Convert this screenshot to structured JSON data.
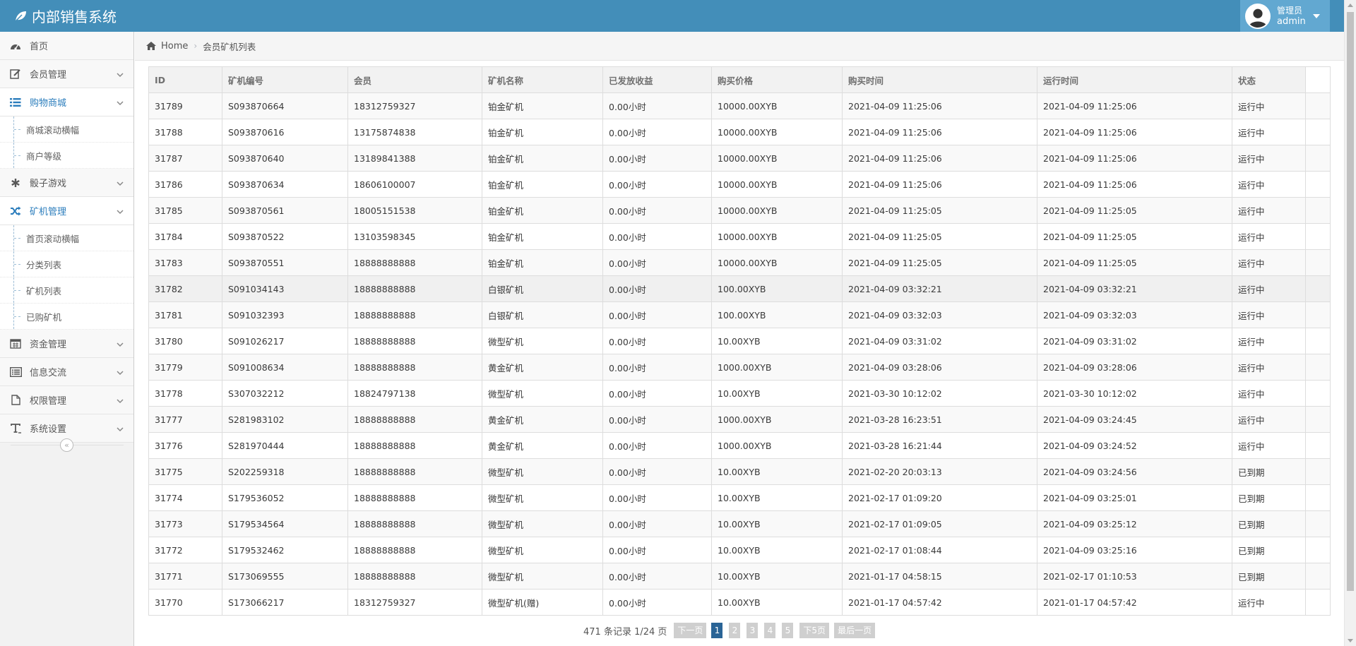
{
  "app": {
    "title": "内部销售系统"
  },
  "user": {
    "role": "管理员",
    "name": "admin"
  },
  "colors": {
    "navbar": "#438eb9",
    "user_menu": "#62a8d1",
    "active_nav": "#2b7dbc",
    "current_page": "#2a6496"
  },
  "sidebar": {
    "items": [
      {
        "label": "首页",
        "icon": "dashboard-icon",
        "active": false,
        "expandable": false
      },
      {
        "label": "会员管理",
        "icon": "edit-icon",
        "active": false,
        "expandable": true
      },
      {
        "label": "购物商城",
        "icon": "list-icon",
        "active": true,
        "expandable": true,
        "children": [
          "商城滚动横幅",
          "商户等级"
        ]
      },
      {
        "label": "骰子游戏",
        "icon": "asterisk-icon",
        "active": false,
        "expandable": true
      },
      {
        "label": "矿机管理",
        "icon": "shuffle-icon",
        "active": true,
        "expandable": true,
        "children": [
          "首页滚动横幅",
          "分类列表",
          "矿机列表",
          "已购矿机"
        ]
      },
      {
        "label": "资金管理",
        "icon": "calendar-icon",
        "active": false,
        "expandable": true
      },
      {
        "label": "信息交流",
        "icon": "list-alt-icon",
        "active": false,
        "expandable": true
      },
      {
        "label": "权限管理",
        "icon": "file-icon",
        "active": false,
        "expandable": true
      },
      {
        "label": "系统设置",
        "icon": "text-icon",
        "active": false,
        "expandable": true
      }
    ]
  },
  "breadcrumb": {
    "home": "Home",
    "current": "会员矿机列表"
  },
  "table": {
    "headers": [
      "ID",
      "矿机编号",
      "会员",
      "矿机名称",
      "已发放收益",
      "购买价格",
      "购买时间",
      "运行时间",
      "状态"
    ],
    "rows": [
      [
        "31789",
        "S093870664",
        "18312759327",
        "铂金矿机",
        "0.00小时",
        "10000.00XYB",
        "2021-04-09 11:25:06",
        "2021-04-09 11:25:06",
        "运行中"
      ],
      [
        "31788",
        "S093870616",
        "13175874838",
        "铂金矿机",
        "0.00小时",
        "10000.00XYB",
        "2021-04-09 11:25:06",
        "2021-04-09 11:25:06",
        "运行中"
      ],
      [
        "31787",
        "S093870640",
        "13189841388",
        "铂金矿机",
        "0.00小时",
        "10000.00XYB",
        "2021-04-09 11:25:06",
        "2021-04-09 11:25:06",
        "运行中"
      ],
      [
        "31786",
        "S093870634",
        "18606100007",
        "铂金矿机",
        "0.00小时",
        "10000.00XYB",
        "2021-04-09 11:25:06",
        "2021-04-09 11:25:06",
        "运行中"
      ],
      [
        "31785",
        "S093870561",
        "18005151538",
        "铂金矿机",
        "0.00小时",
        "10000.00XYB",
        "2021-04-09 11:25:05",
        "2021-04-09 11:25:05",
        "运行中"
      ],
      [
        "31784",
        "S093870522",
        "13103598345",
        "铂金矿机",
        "0.00小时",
        "10000.00XYB",
        "2021-04-09 11:25:05",
        "2021-04-09 11:25:05",
        "运行中"
      ],
      [
        "31783",
        "S093870551",
        "18888888888",
        "铂金矿机",
        "0.00小时",
        "10000.00XYB",
        "2021-04-09 11:25:05",
        "2021-04-09 11:25:05",
        "运行中"
      ],
      [
        "31782",
        "S091034143",
        "18888888888",
        "白银矿机",
        "0.00小时",
        "100.00XYB",
        "2021-04-09 03:32:21",
        "2021-04-09 03:32:21",
        "运行中"
      ],
      [
        "31781",
        "S091032393",
        "18888888888",
        "白银矿机",
        "0.00小时",
        "100.00XYB",
        "2021-04-09 03:32:03",
        "2021-04-09 03:32:03",
        "运行中"
      ],
      [
        "31780",
        "S091026217",
        "18888888888",
        "微型矿机",
        "0.00小时",
        "10.00XYB",
        "2021-04-09 03:31:02",
        "2021-04-09 03:31:02",
        "运行中"
      ],
      [
        "31779",
        "S091008634",
        "18888888888",
        "黄金矿机",
        "0.00小时",
        "1000.00XYB",
        "2021-04-09 03:28:06",
        "2021-04-09 03:28:06",
        "运行中"
      ],
      [
        "31778",
        "S307032212",
        "18824797138",
        "微型矿机",
        "0.00小时",
        "10.00XYB",
        "2021-03-30 10:12:02",
        "2021-03-30 10:12:02",
        "运行中"
      ],
      [
        "31777",
        "S281983102",
        "18888888888",
        "黄金矿机",
        "0.00小时",
        "1000.00XYB",
        "2021-03-28 16:23:51",
        "2021-04-09 03:24:45",
        "运行中"
      ],
      [
        "31776",
        "S281970444",
        "18888888888",
        "黄金矿机",
        "0.00小时",
        "1000.00XYB",
        "2021-03-28 16:21:44",
        "2021-04-09 03:24:52",
        "运行中"
      ],
      [
        "31775",
        "S202259318",
        "18888888888",
        "微型矿机",
        "0.00小时",
        "10.00XYB",
        "2021-02-20 20:03:13",
        "2021-04-09 03:24:56",
        "已到期"
      ],
      [
        "31774",
        "S179536052",
        "18888888888",
        "微型矿机",
        "0.00小时",
        "10.00XYB",
        "2021-02-17 01:09:20",
        "2021-04-09 03:25:01",
        "已到期"
      ],
      [
        "31773",
        "S179534564",
        "18888888888",
        "微型矿机",
        "0.00小时",
        "10.00XYB",
        "2021-02-17 01:09:05",
        "2021-04-09 03:25:12",
        "已到期"
      ],
      [
        "31772",
        "S179532462",
        "18888888888",
        "微型矿机",
        "0.00小时",
        "10.00XYB",
        "2021-02-17 01:08:44",
        "2021-04-09 03:25:16",
        "已到期"
      ],
      [
        "31771",
        "S173069555",
        "18888888888",
        "微型矿机",
        "0.00小时",
        "10.00XYB",
        "2021-01-17 04:58:15",
        "2021-02-17 01:10:53",
        "已到期"
      ],
      [
        "31770",
        "S173066217",
        "18312759327",
        "微型矿机(赠)",
        "0.00小时",
        "10.00XYB",
        "2021-01-17 04:57:42",
        "2021-01-17 04:57:42",
        "运行中"
      ]
    ]
  },
  "pagination": {
    "info": "471 条记录 1/24 页",
    "prev": "下一页",
    "pages": [
      "1",
      "2",
      "3",
      "4",
      "5"
    ],
    "current": "1",
    "next5": "下5页",
    "last": "最后一页"
  }
}
